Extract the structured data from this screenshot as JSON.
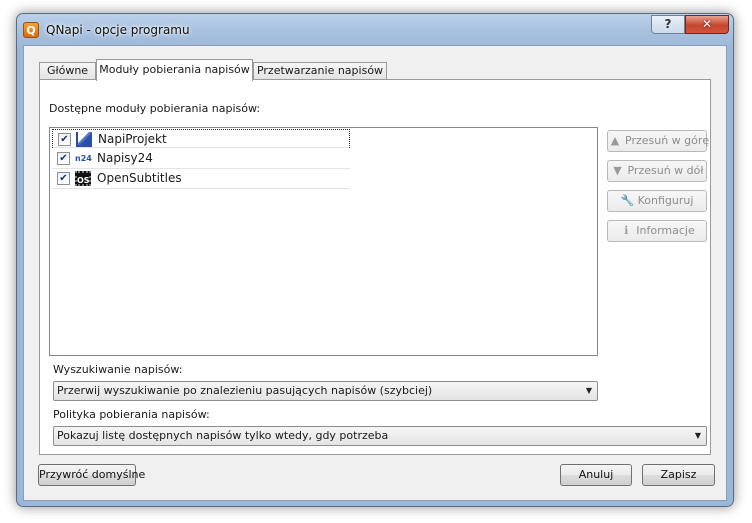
{
  "window": {
    "title": "QNapi - opcje programu",
    "app_icon_letter": "Q",
    "help_glyph": "?",
    "close_glyph": "✕"
  },
  "tabs": [
    {
      "label": "Główne",
      "active": false
    },
    {
      "label": "Moduły pobierania napisów",
      "active": true
    },
    {
      "label": "Przetwarzanie napisów",
      "active": false
    }
  ],
  "modules": {
    "label": "Dostępne moduły pobierania napisów:",
    "items": [
      {
        "label": "NapiProjekt",
        "checked": true,
        "icon": "napiprojekt-icon",
        "icon_text": ""
      },
      {
        "label": "Napisy24",
        "checked": true,
        "icon": "napisy24-icon",
        "icon_text": "n24"
      },
      {
        "label": "OpenSubtitles",
        "checked": true,
        "icon": "opensubtitles-icon",
        "icon_text": "OS"
      }
    ],
    "check_glyph": "✔"
  },
  "side_buttons": {
    "move_up": {
      "label": "Przesuń w górę",
      "icon": "arrow-up-icon",
      "glyph": "▲",
      "enabled": false
    },
    "move_down": {
      "label": "Przesuń w dół",
      "icon": "arrow-down-icon",
      "glyph": "▼",
      "enabled": false
    },
    "configure": {
      "label": "Konfiguruj",
      "icon": "wrench-icon",
      "glyph": "🔧",
      "enabled": false
    },
    "info": {
      "label": "Informacje",
      "icon": "info-icon",
      "glyph": "ℹ",
      "enabled": false
    }
  },
  "search": {
    "label": "Wyszukiwanie napisów:",
    "value": "Przerwij wyszukiwanie po znalezieniu pasujących napisów (szybciej)"
  },
  "policy": {
    "label": "Polityka pobierania napisów:",
    "value": "Pokazuj listę dostępnych napisów tylko wtedy, gdy potrzeba"
  },
  "footer": {
    "restore_defaults": "Przywróć domyślne",
    "cancel": "Anuluj",
    "save": "Zapisz"
  }
}
